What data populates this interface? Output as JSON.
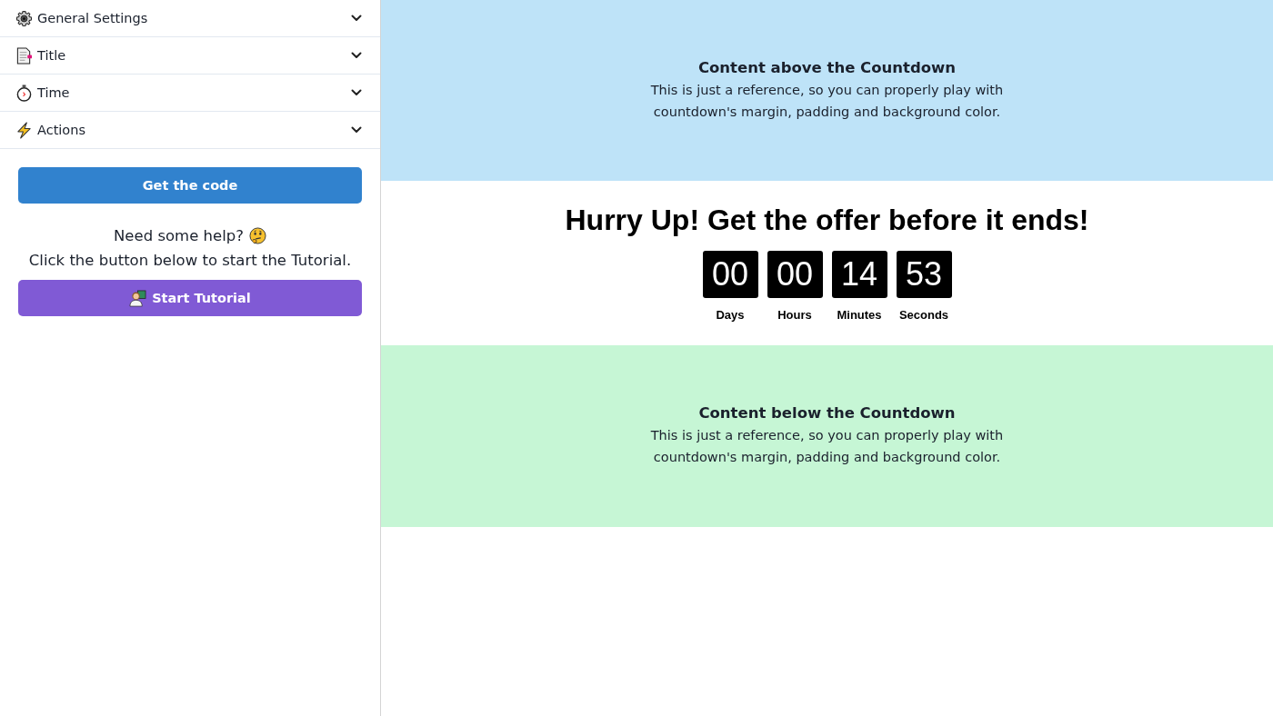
{
  "sidebar": {
    "sections": [
      {
        "label": "General Settings",
        "kind": "gear",
        "expanded": false
      },
      {
        "label": "Title",
        "kind": "document",
        "expanded": false
      },
      {
        "label": "Time",
        "kind": "stopwatch",
        "expanded": false
      },
      {
        "label": "Actions",
        "kind": "lightning",
        "expanded": false
      }
    ],
    "code_button": "Get the code",
    "help": {
      "question": "Need some help?",
      "instruction": "Click the button below to start the Tutorial."
    },
    "tutorial_button": "Start Tutorial"
  },
  "preview": {
    "above": {
      "heading": "Content above the Countdown",
      "text": "This is just a reference, so you can properly play with countdown's margin, padding and background color."
    },
    "countdown": {
      "title": "Hurry Up! Get the offer before it ends!",
      "units": [
        {
          "value": "00",
          "label": "Days"
        },
        {
          "value": "00",
          "label": "Hours"
        },
        {
          "value": "14",
          "label": "Minutes"
        },
        {
          "value": "53",
          "label": "Seconds"
        }
      ]
    },
    "below": {
      "heading": "Content below the Countdown",
      "text": "This is just a reference, so you can properly play with countdown's margin, padding and background color."
    }
  }
}
